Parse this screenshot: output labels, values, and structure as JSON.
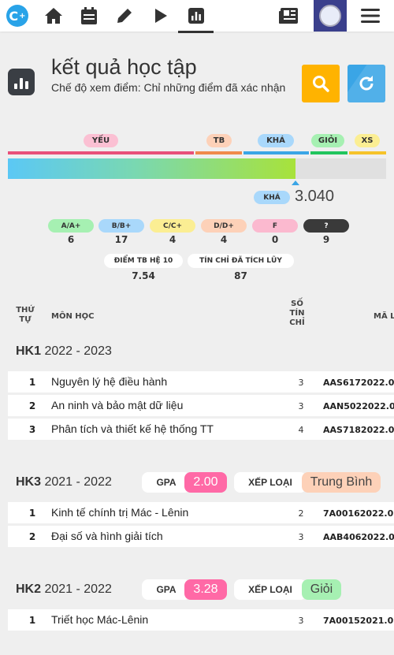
{
  "page": {
    "title": "kết quả học tập",
    "view_mode": "Chế độ xem điểm: Chỉ những điểm đã xác nhận"
  },
  "topbar": {
    "icons": [
      "logo-icon",
      "home-icon",
      "calendar-icon",
      "pencil-icon",
      "play-icon",
      "chart-icon",
      "news-icon",
      "avatar",
      "menu-icon"
    ],
    "active": "chart-icon"
  },
  "scale": {
    "labels": {
      "yeu": "YẾU",
      "tb": "TB",
      "kha": "KHÁ",
      "gioi": "GIỎI",
      "xs": "XS"
    },
    "colors": {
      "yeu": "#e8507a",
      "tb": "#f08a4b",
      "kha": "#3aa5e6",
      "gioi": "#22c55e",
      "xs": "#f6c32a"
    },
    "progress_fraction": 0.76,
    "current_rank": "KHÁ",
    "current_score": "3.040"
  },
  "grades": [
    {
      "label": "A/A+",
      "count": "6",
      "color": "#a6f0b2"
    },
    {
      "label": "B/B+",
      "count": "17",
      "color": "#a9d8fb"
    },
    {
      "label": "C/C+",
      "count": "4",
      "color": "#fbee93"
    },
    {
      "label": "D/D+",
      "count": "4",
      "color": "#fdd1b8"
    },
    {
      "label": "F",
      "count": "0",
      "color": "#fbb9cf"
    },
    {
      "label": "?",
      "count": "9",
      "color": "#3a3a3a"
    }
  ],
  "stats": {
    "gpa10_label": "ĐIỂM TB HỆ 10",
    "gpa10_value": "7.54",
    "credits_label": "TÍN CHỈ ĐÃ TÍCH LŨY",
    "credits_value": "87"
  },
  "table_header": {
    "order_1": "THỨ",
    "order_2": "TỰ",
    "subject": "MÔN HỌC",
    "credits_1": "SỐ",
    "credits_2": "TÍN",
    "credits_3": "CHỈ",
    "code": "MÃ L"
  },
  "semesters": [
    {
      "name": "HK1",
      "years": "2022 - 2023",
      "gpa_label": "",
      "gpa": "",
      "rank_label": "",
      "rank": "",
      "rows": [
        {
          "no": "1",
          "subject": "Nguyên lý hệ điều hành",
          "credits": "3",
          "code": "AAS6172022.0"
        },
        {
          "no": "2",
          "subject": "An ninh và bảo mật dữ liệu",
          "credits": "3",
          "code": "AAN5022022.0"
        },
        {
          "no": "3",
          "subject": "Phân tích và thiết kế hệ thống TT",
          "credits": "4",
          "code": "AAS7182022.0"
        }
      ]
    },
    {
      "name": "HK3",
      "years": "2021 - 2022",
      "gpa_label": "GPA",
      "gpa": "2.00",
      "rank_label": "XẾP LOẠI",
      "rank": "Trung Bình",
      "rank_color": "#fdd1b8",
      "rows": [
        {
          "no": "1",
          "subject": "Kinh tế chính trị Mác - Lênin",
          "credits": "2",
          "code": "7A00162022.0"
        },
        {
          "no": "2",
          "subject": "Đại số và hình giải tích",
          "credits": "3",
          "code": "AAB4062022.0"
        }
      ]
    },
    {
      "name": "HK2",
      "years": "2021 - 2022",
      "gpa_label": "GPA",
      "gpa": "3.28",
      "rank_label": "XẾP LOẠI",
      "rank": "Giỏi",
      "rank_color": "#a6f0b2",
      "rows": [
        {
          "no": "1",
          "subject": "Triết học Mác-Lênin",
          "credits": "3",
          "code": "7A00152021.0"
        }
      ]
    }
  ]
}
